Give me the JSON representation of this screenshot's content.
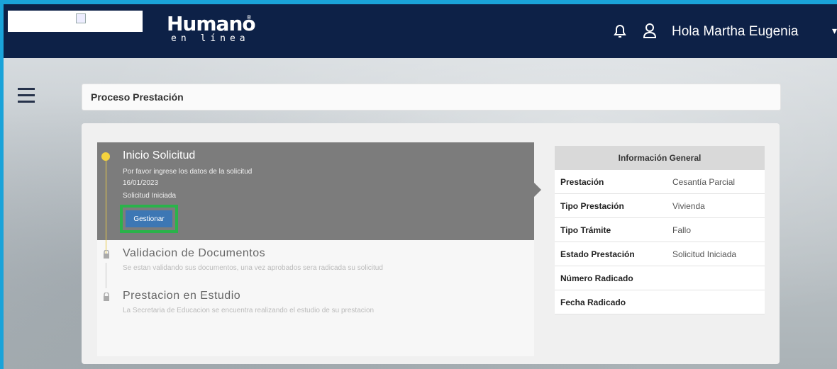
{
  "brand": {
    "name": "Humano",
    "tagline": "en línea",
    "reg": "®"
  },
  "header": {
    "greeting": "Hola Martha Eugenia"
  },
  "page": {
    "title": "Proceso Prestación"
  },
  "steps": [
    {
      "title": "Inicio Solicitud",
      "desc": "Por favor ingrese los datos de la solicitud",
      "date": "16/01/2023",
      "status": "Solicitud Iniciada",
      "button": "Gestionar"
    },
    {
      "title": "Validacion de Documentos",
      "desc": "Se estan validando sus documentos, una vez aprobados sera radicada su solicitud"
    },
    {
      "title": "Prestacion en Estudio",
      "desc": "La Secretaria de Educacion se encuentra realizando el estudio de su prestacion"
    }
  ],
  "info": {
    "title": "Información General",
    "rows": [
      {
        "label": "Prestación",
        "value": "Cesantía Parcial"
      },
      {
        "label": "Tipo Prestación",
        "value": "Vivienda"
      },
      {
        "label": "Tipo Trámite",
        "value": "Fallo"
      },
      {
        "label": "Estado Prestación",
        "value": "Solicitud Iniciada"
      },
      {
        "label": "Número Radicado",
        "value": ""
      },
      {
        "label": "Fecha Radicado",
        "value": ""
      }
    ]
  },
  "colors": {
    "header": "#0d2147",
    "active_step": "#7c7c7c",
    "dot": "#f5d33e",
    "button": "#3d77b4",
    "highlight": "#2ab34a"
  }
}
